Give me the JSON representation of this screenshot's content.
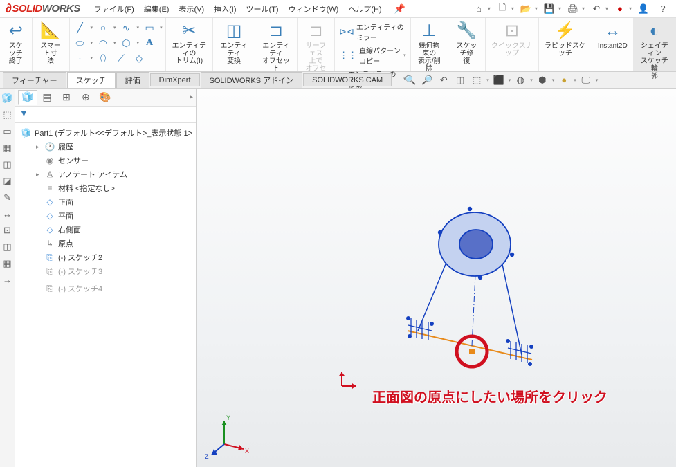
{
  "app": {
    "logo_left": "SOLID",
    "logo_right": "WORKS"
  },
  "menus": [
    "ファイル(F)",
    "編集(E)",
    "表示(V)",
    "挿入(I)",
    "ツール(T)",
    "ウィンドウ(W)",
    "ヘルプ(H)"
  ],
  "ribbon": {
    "exitSketch": "スケッチ\n終了",
    "smartDim": "スマート寸\n法",
    "entityTrim": "エンティティの\nトリム(I)",
    "entityConv": "エンティティ\n変換",
    "entityOffset": "エンティティ\nオフセット",
    "surfaceOffset": "サーフェス\n上で\nオフセット",
    "mirror": "エンティティのミラー",
    "linPattern": "直線パターン コピー",
    "move": "エンティティの移動",
    "constraints": "幾何拘束の\n表示/削除",
    "repair": "スケッチ修\n復",
    "quickSnap": "クイックスナップ",
    "rapid": "ラピッドスケッチ",
    "instant2d": "Instant2D",
    "shaded": "シェイディン\nスケッチ輪\n郭"
  },
  "tabs": [
    "フィーチャー",
    "スケッチ",
    "評価",
    "DimXpert",
    "SOLIDWORKS アドイン",
    "SOLIDWORKS CAM"
  ],
  "activeTab": "スケッチ",
  "tree": {
    "root": "Part1 (デフォルト<<デフォルト>_表示状態 1>",
    "items": [
      {
        "icon": "history",
        "label": "履歴",
        "expandable": true
      },
      {
        "icon": "sensor",
        "label": "センサー"
      },
      {
        "icon": "annot",
        "label": "アノテート アイテム",
        "expandable": true
      },
      {
        "icon": "material",
        "label": "材料 <指定なし>"
      },
      {
        "icon": "plane",
        "label": "正面"
      },
      {
        "icon": "plane",
        "label": "平面"
      },
      {
        "icon": "plane",
        "label": "右側面"
      },
      {
        "icon": "origin",
        "label": "原点"
      },
      {
        "icon": "sketch",
        "label": "(-) スケッチ2"
      },
      {
        "icon": "sketch",
        "label": "(-) スケッチ3"
      },
      {
        "icon": "sketch",
        "label": "(-) スケッチ4"
      }
    ]
  },
  "annotation": "正面図の原点にしたい場所をクリック",
  "triad": {
    "x": "X",
    "y": "Y",
    "z": "Z"
  }
}
